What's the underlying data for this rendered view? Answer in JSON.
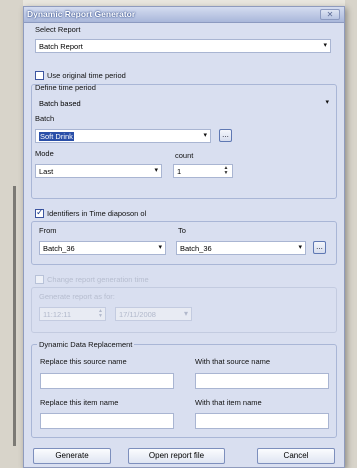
{
  "window": {
    "title": "Dynamic Report Generator",
    "close_glyph": "✕"
  },
  "select_report": {
    "label": "Select Report",
    "value": "Batch Report"
  },
  "use_original_time": {
    "label": "Use original time period",
    "checked": false
  },
  "define_time": {
    "label": "Define time period",
    "value": "Batch based"
  },
  "batch": {
    "label": "Batch",
    "value": "Soft Drink",
    "browse": "..."
  },
  "mode": {
    "label": "Mode",
    "value": "Last"
  },
  "count": {
    "label": "count",
    "value": "1"
  },
  "identifiers": {
    "label": "Identifiers in Time diaposon ol",
    "checked": true
  },
  "from": {
    "label": "From",
    "value": "Batch_36"
  },
  "to": {
    "label": "To",
    "value": "Batch_36",
    "browse": "..."
  },
  "change_generation": {
    "label": "Change report generation time",
    "checked": false
  },
  "generate_at": {
    "label": "Generate report as for:",
    "time": "11:12:11",
    "date": "17/11/2008"
  },
  "dynamic_data": {
    "legend": "Dynamic Data Replacement",
    "replace_source_label": "Replace this source name",
    "with_source_label": "With that source name",
    "replace_item_label": "Replace this item name",
    "with_item_label": "With that item name"
  },
  "buttons": {
    "generate": "Generate",
    "open_report": "Open report file",
    "cancel": "Cancel"
  },
  "glyphs": {
    "dropdown": "▾",
    "up": "▲",
    "down": "▼"
  },
  "colors": {
    "title_bar": "#a9b7da",
    "window_bg": "#d9dff0",
    "selection": "#2a4fa8"
  }
}
